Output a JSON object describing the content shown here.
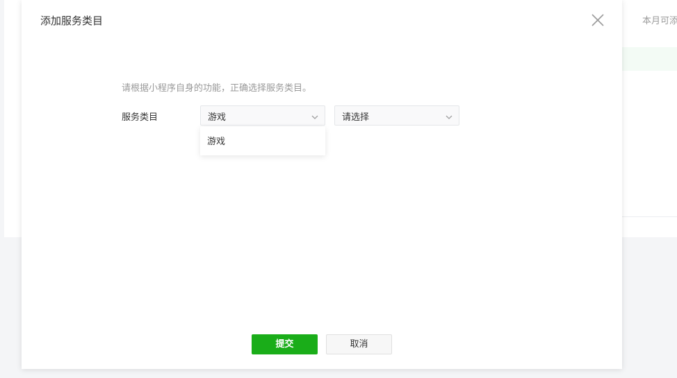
{
  "background": {
    "partial_text": "本月可添"
  },
  "dialog": {
    "title": "添加服务类目",
    "tip": "请根据小程序自身的功能，正确选择服务类目。",
    "field_label": "服务类目",
    "category_select": {
      "selected": "游戏",
      "expanded": true,
      "options": [
        "游戏"
      ]
    },
    "subcategory_select": {
      "placeholder": "请选择"
    },
    "buttons": {
      "submit": "提交",
      "cancel": "取消"
    }
  },
  "colors": {
    "primary": "#1aad19",
    "text": "#353535",
    "muted": "#999999"
  },
  "icons": {
    "close": "close-icon",
    "chevron": "chevron-down-icon"
  }
}
